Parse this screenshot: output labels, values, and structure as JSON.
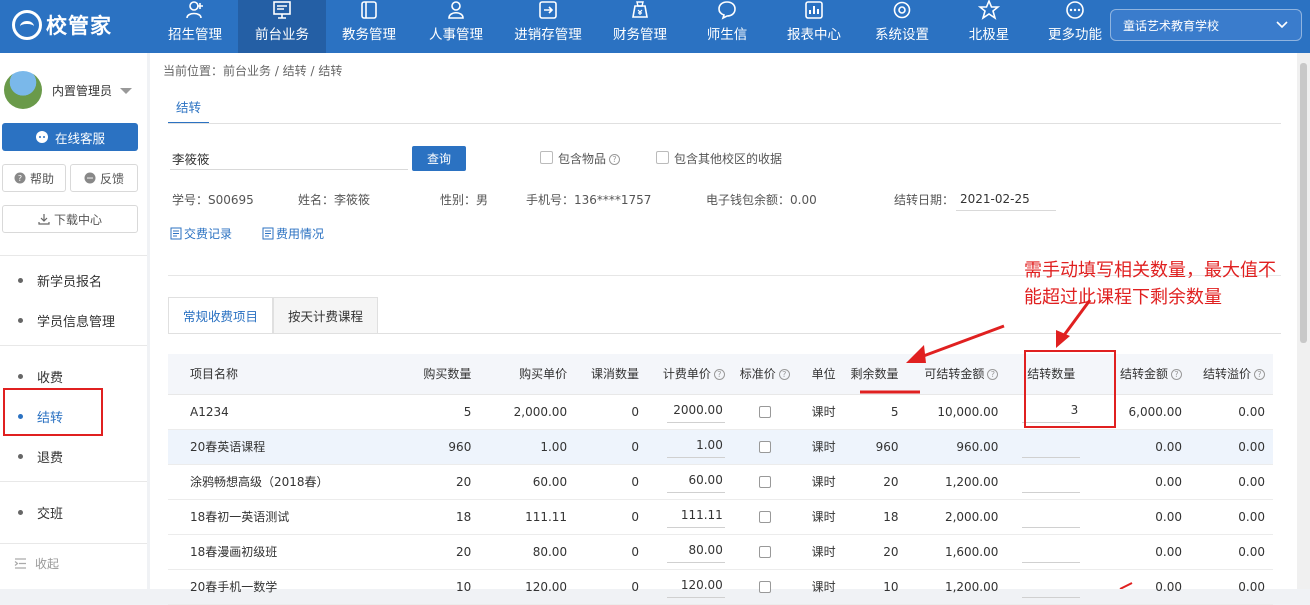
{
  "brand": {
    "name": "校管家"
  },
  "nav": [
    {
      "label": "招生管理",
      "icon": "user-plus-icon"
    },
    {
      "label": "前台业务",
      "icon": "monitor-icon",
      "active": true
    },
    {
      "label": "教务管理",
      "icon": "book-icon"
    },
    {
      "label": "人事管理",
      "icon": "person-icon"
    },
    {
      "label": "进销存管理",
      "icon": "inventory-icon"
    },
    {
      "label": "财务管理",
      "icon": "money-bag-icon"
    },
    {
      "label": "师生信",
      "icon": "chat-icon"
    },
    {
      "label": "报表中心",
      "icon": "chart-icon"
    },
    {
      "label": "系统设置",
      "icon": "settings-icon"
    },
    {
      "label": "北极星",
      "icon": "star-icon"
    },
    {
      "label": "更多功能",
      "icon": "more-icon"
    }
  ],
  "school": {
    "name": "童话艺术教育学校"
  },
  "sidebar": {
    "user": "内置管理员",
    "online_service": "在线客服",
    "help": "帮助",
    "feedback": "反馈",
    "download": "下载中心",
    "items": [
      "新学员报名",
      "学员信息管理",
      "收费",
      "结转",
      "退费",
      "交班"
    ],
    "active_item": "结转",
    "collapse": "收起"
  },
  "breadcrumb": "当前位置：前台业务 / 结转 / 结转",
  "page_tab": "结转",
  "search": {
    "value": "李筱筱",
    "button": "查询",
    "include_goods": "包含物品",
    "include_other": "包含其他校区的收据"
  },
  "student": {
    "id": "学号：S00695",
    "name": "姓名：李筱筱",
    "gender": "性别：男",
    "phone": "手机号：136****1757",
    "wallet": "电子钱包余额：0.00",
    "date_label": "结转日期：",
    "date": "2021-02-25"
  },
  "links": {
    "payment_record": "交费记录",
    "fee_status": "费用情况"
  },
  "subtabs": [
    "常规收费项目",
    "按天计费课程"
  ],
  "table": {
    "headers": [
      "项目名称",
      "购买数量",
      "购买单价",
      "课消数量",
      "计费单价",
      "标准价",
      "单位",
      "剩余数量",
      "可结转金额",
      "结转数量",
      "结转金额",
      "结转溢价"
    ],
    "rows": [
      {
        "name": "A1234",
        "qty": "5",
        "price": "2,000.00",
        "consumed": "0",
        "unit_price": "2000.00",
        "unit": "课时",
        "remain": "5",
        "avail": "10,000.00",
        "transfer_qty": "3",
        "transfer_amt": "6,000.00",
        "premium": "0.00"
      },
      {
        "name": "20春英语课程",
        "qty": "960",
        "price": "1.00",
        "consumed": "0",
        "unit_price": "1.00",
        "unit": "课时",
        "remain": "960",
        "avail": "960.00",
        "transfer_qty": "",
        "transfer_amt": "0.00",
        "premium": "0.00"
      },
      {
        "name": "涂鸦畅想高级（2018春）",
        "qty": "20",
        "price": "60.00",
        "consumed": "0",
        "unit_price": "60.00",
        "unit": "课时",
        "remain": "20",
        "avail": "1,200.00",
        "transfer_qty": "",
        "transfer_amt": "0.00",
        "premium": "0.00"
      },
      {
        "name": "18春初一英语测试",
        "qty": "18",
        "price": "111.11",
        "consumed": "0",
        "unit_price": "111.11",
        "unit": "课时",
        "remain": "18",
        "avail": "2,000.00",
        "transfer_qty": "",
        "transfer_amt": "0.00",
        "premium": "0.00"
      },
      {
        "name": "18春漫画初级班",
        "qty": "20",
        "price": "80.00",
        "consumed": "0",
        "unit_price": "80.00",
        "unit": "课时",
        "remain": "20",
        "avail": "1,600.00",
        "transfer_qty": "",
        "transfer_amt": "0.00",
        "premium": "0.00"
      },
      {
        "name": "20春手机一数学",
        "qty": "10",
        "price": "120.00",
        "consumed": "0",
        "unit_price": "120.00",
        "unit": "课时",
        "remain": "10",
        "avail": "1,200.00",
        "transfer_qty": "",
        "transfer_amt": "0.00",
        "premium": "0.00"
      }
    ]
  },
  "annotation": {
    "text": "需手动填写相关数量，最大值不能超过此课程下剩余数量",
    "color": "#e02020"
  },
  "colors": {
    "primary": "#2b72c2",
    "topbar": "#2b72c2",
    "annotation": "#e02020"
  }
}
